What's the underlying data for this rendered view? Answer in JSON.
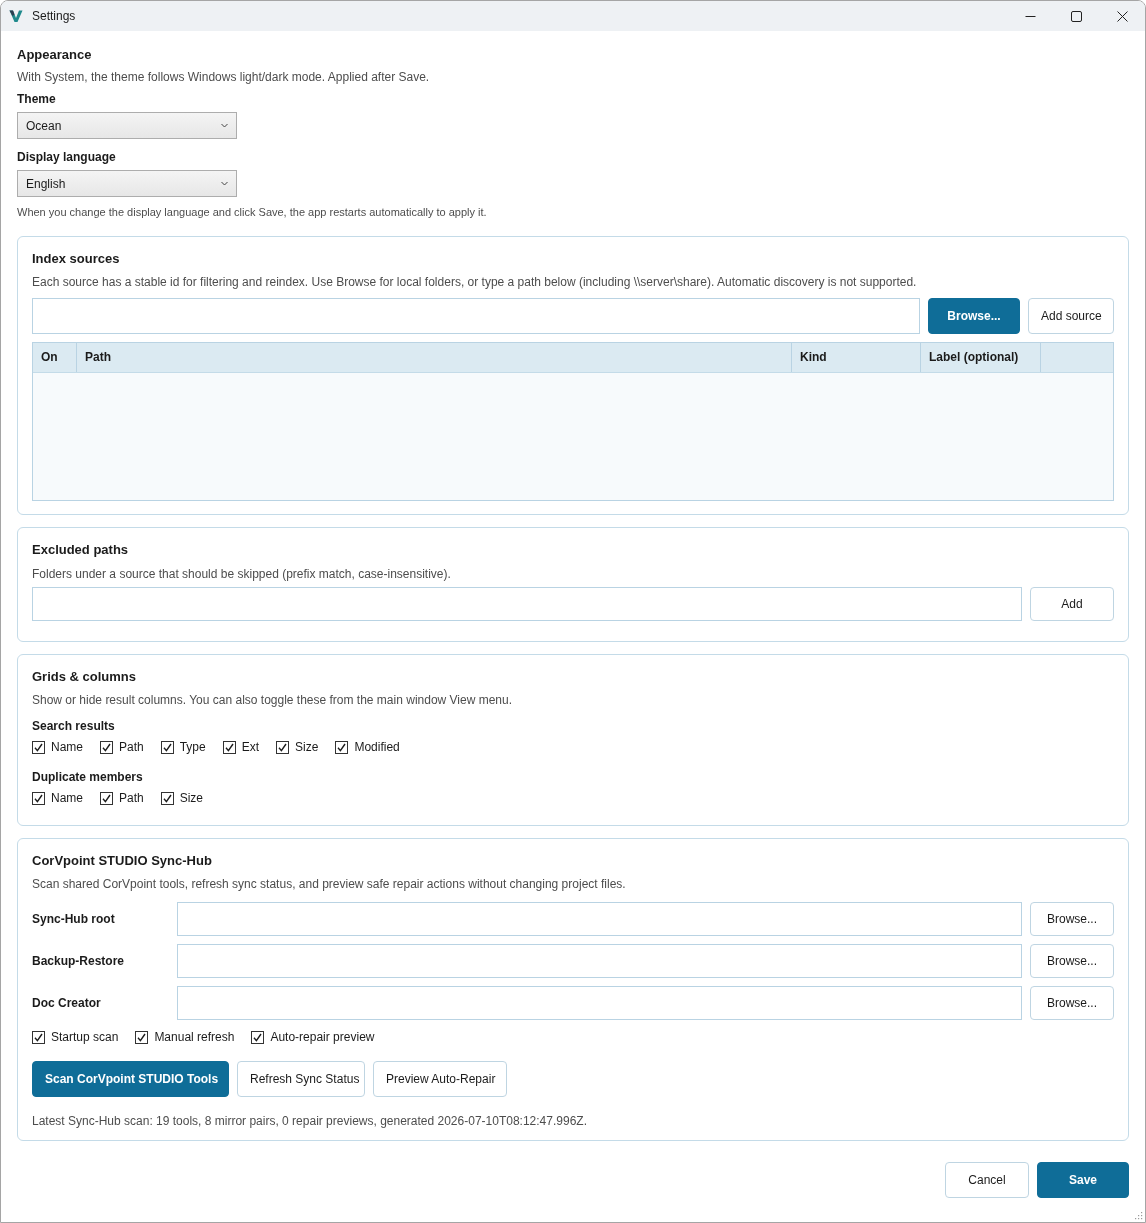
{
  "window": {
    "title": "Settings"
  },
  "appearance": {
    "heading": "Appearance",
    "description": "With System, the theme follows Windows light/dark mode. Applied after Save.",
    "dropdowns": [
      {
        "label": "Theme",
        "value": "Ocean"
      },
      {
        "label": "Display language",
        "value": "English"
      }
    ],
    "note": "When you change the display language and click Save, the app restarts automatically to apply it."
  },
  "index_sources": {
    "heading": "Index sources",
    "description": "Each source has a stable id for filtering and reindex. Use Browse for local folders, or type a path below (including \\\\server\\share). Automatic discovery is not supported.",
    "buttons": [
      {
        "label": "Browse...",
        "kind": "primary"
      },
      {
        "label": "Add source",
        "kind": "secondary"
      }
    ],
    "table": {
      "columns": [
        "On",
        "Path",
        "Kind",
        "Label (optional)"
      ]
    }
  },
  "excluded_paths": {
    "heading": "Excluded paths",
    "description": "Folders under a source that should be skipped (prefix match, case-insensitive).",
    "buttons": [
      {
        "label": "Add",
        "kind": "secondary"
      }
    ]
  },
  "grids": {
    "heading": "Grids & columns",
    "description": "Show or hide result columns. You can also toggle these from the main window View menu.",
    "groups": [
      {
        "label": "Search results",
        "options": [
          {
            "label": "Name",
            "checked": true
          },
          {
            "label": "Path",
            "checked": true
          },
          {
            "label": "Type",
            "checked": true
          },
          {
            "label": "Ext",
            "checked": true
          },
          {
            "label": "Size",
            "checked": true
          },
          {
            "label": "Modified",
            "checked": true
          }
        ]
      },
      {
        "label": "Duplicate members",
        "options": [
          {
            "label": "Name",
            "checked": true
          },
          {
            "label": "Path",
            "checked": true
          },
          {
            "label": "Size",
            "checked": true
          }
        ]
      }
    ]
  },
  "sync_hub": {
    "heading": "CorVpoint STUDIO Sync-Hub",
    "description": "Scan shared CorVpoint tools, refresh sync status, and preview safe repair actions without changing project files.",
    "paths": [
      {
        "label": "Sync-Hub root",
        "button": "Browse..."
      },
      {
        "label": "Backup-Restore",
        "button": "Browse..."
      },
      {
        "label": "Doc Creator",
        "button": "Browse..."
      }
    ],
    "options": [
      {
        "label": "Startup scan",
        "checked": true
      },
      {
        "label": "Manual refresh",
        "checked": true
      },
      {
        "label": "Auto-repair preview",
        "checked": true
      }
    ],
    "actions": [
      {
        "label": "Scan CorVpoint STUDIO Tools",
        "kind": "primary"
      },
      {
        "label": "Refresh Sync Status",
        "kind": "secondary"
      },
      {
        "label": "Preview Auto-Repair",
        "kind": "secondary"
      }
    ],
    "status": "Latest Sync-Hub scan: 19 tools, 8 mirror pairs, 0 repair previews, generated 2026-07-10T08:12:47.996Z."
  },
  "footer": {
    "buttons": [
      {
        "label": "Cancel",
        "kind": "secondary"
      },
      {
        "label": "Save",
        "kind": "primary"
      }
    ]
  }
}
